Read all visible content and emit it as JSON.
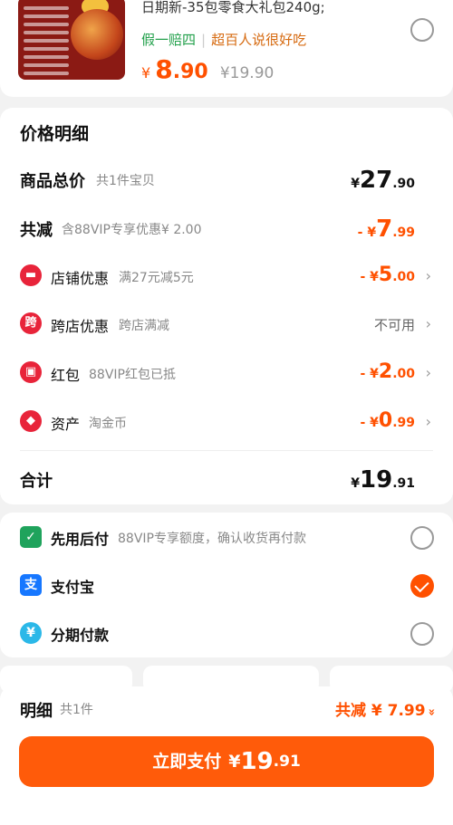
{
  "product": {
    "title": "日期新-35包零食大礼包240g;",
    "tag1": "假一赔四",
    "tag_sep": "|",
    "tag2": "超百人说很好吃",
    "price_yen": "¥",
    "price_int": "8",
    "price_dec": ".90",
    "price_orig": "¥19.90"
  },
  "detail": {
    "title": "价格明细",
    "total": {
      "label": "商品总价",
      "sub": "共1件宝贝",
      "yen": "¥",
      "int": "27",
      "dec": ".90"
    },
    "reduce": {
      "label": "共减",
      "sub": "含88VIP专享优惠¥ 2.00",
      "prefix": "- ¥",
      "int": "7",
      "dec": ".99"
    },
    "shop": {
      "label": "店铺优惠",
      "sub": "满27元减5元",
      "prefix": "- ¥",
      "int": "5",
      "dec": ".00",
      "chevron": "›"
    },
    "cross": {
      "label": "跨店优惠",
      "sub": "跨店满减",
      "value": "不可用",
      "chevron": "›",
      "icon_text": "跨"
    },
    "redpack": {
      "label": "红包",
      "sub": "88VIP红包已抵",
      "prefix": "- ¥",
      "int": "2",
      "dec": ".00",
      "chevron": "›"
    },
    "asset": {
      "label": "资产",
      "sub": "淘金币",
      "prefix": "- ¥",
      "int": "0",
      "dec": ".99",
      "chevron": "›"
    },
    "sum": {
      "label": "合计",
      "yen": "¥",
      "int": "19",
      "dec": ".91"
    }
  },
  "payment": {
    "methods": [
      {
        "label": "先用后付",
        "sub": "88VIP专享额度，确认收货再付款",
        "selected": false,
        "icon": "bag-icon",
        "color": "#1fa35c"
      },
      {
        "label": "支付宝",
        "sub": "",
        "selected": true,
        "icon": "alipay-icon",
        "icon_text": "支",
        "color": "#1677ff"
      },
      {
        "label": "分期付款",
        "sub": "",
        "selected": false,
        "icon": "installment-icon",
        "icon_text": "¥",
        "color": "#2bb8e8"
      }
    ]
  },
  "bottom": {
    "title": "明细",
    "count": "共1件",
    "save": "共减 ¥ 7.99",
    "save_icon": "»",
    "pay_label": "立即支付",
    "pay_yen": "¥",
    "pay_int": "19",
    "pay_dec": ".91"
  },
  "colors": {
    "accent": "#ff5000",
    "green_tag": "#22a04b",
    "red_icon": "#e8243a"
  }
}
